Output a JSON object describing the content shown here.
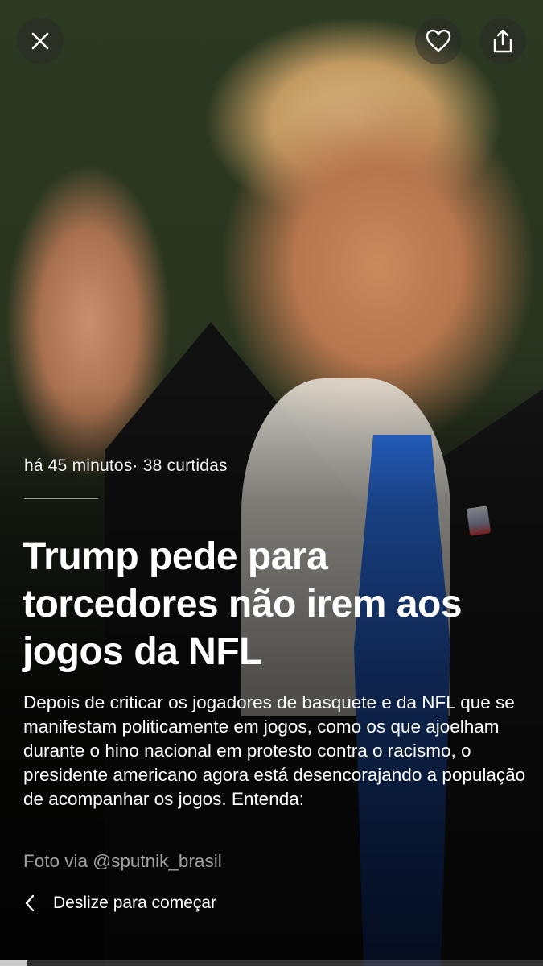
{
  "story": {
    "time_ago": "há 45 minutos",
    "separator": "·",
    "likes": "38 curtidas",
    "headline": "Trump pede para torcedores não irem aos jogos da NFL",
    "body": "Depois de criticar os jogadores de basquete e da NFL que se manifestam politicamente em jogos, como os que ajoelham durante o hino nacional em protesto contra o racismo, o presidente americano agora está desencorajando a população de acompanhar os jogos. Entenda:",
    "photo_credit": "Foto via @sputnik_brasil"
  },
  "controls": {
    "close_icon": "close-icon",
    "like_icon": "heart-icon",
    "share_icon": "share-icon"
  },
  "footer": {
    "swipe_label": "Deslize para começar",
    "swipe_icon": "chevron-left-icon"
  },
  "progress": {
    "fraction": 0.05
  },
  "colors": {
    "text": "#ffffff",
    "muted_text": "#a8a8a8",
    "tie_blue": "#2a6bd8"
  }
}
